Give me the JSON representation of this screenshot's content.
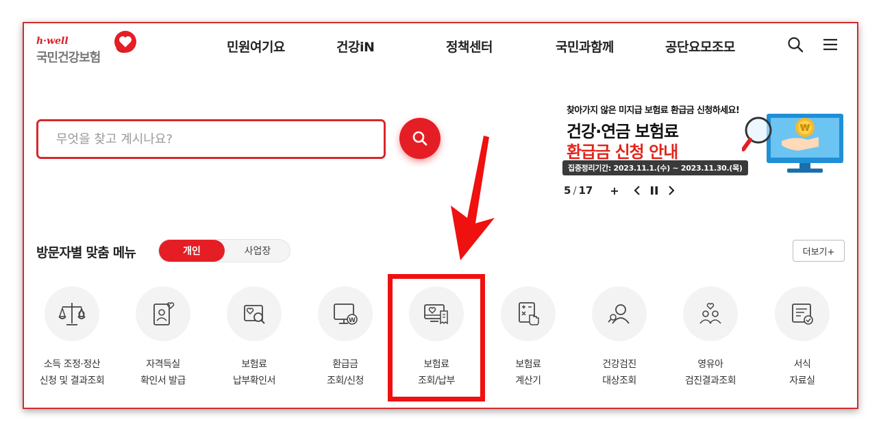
{
  "logo": {
    "brand": "h·well",
    "name": "국민건강보험"
  },
  "nav": {
    "items": [
      "민원여기요",
      "건강iN",
      "정책센터",
      "국민과함께",
      "공단요모조모"
    ]
  },
  "header_icons": [
    "search-icon",
    "hamburger-menu-icon"
  ],
  "search": {
    "placeholder": "무엇을 찾고 계시나요?",
    "value": ""
  },
  "banner": {
    "top_text": "찾아가지 않은 미지급 보험료 환급금 신청하세요!",
    "line1": "건강·연금 보험료",
    "line2": "환급금 신청 안내",
    "period": "집중정리기간: 2023.11.1.(수) ~ 2023.11.30.(목)"
  },
  "pager": {
    "current": "5",
    "total": "17",
    "plus": "+"
  },
  "visitor_menu": {
    "title": "방문자별 맞춤 메뉴",
    "toggle": [
      "개인",
      "사업장"
    ],
    "active_toggle": "개인",
    "more_label": "더보기+",
    "items": [
      {
        "line1": "소득 조정·정산",
        "line2": "신청 및 결과조회",
        "icon": "scale-icon"
      },
      {
        "line1": "자격득실",
        "line2": "확인서 발급",
        "icon": "id-card-heart-icon"
      },
      {
        "line1": "보험료",
        "line2": "납부확인서",
        "icon": "document-search-icon"
      },
      {
        "line1": "환급금",
        "line2": "조회/신청",
        "icon": "monitor-won-icon"
      },
      {
        "line1": "보험료",
        "line2": "조회/납부",
        "icon": "monitor-receipt-icon"
      },
      {
        "line1": "보험료",
        "line2": "계산기",
        "icon": "calculator-icon"
      },
      {
        "line1": "건강검진",
        "line2": "대상조회",
        "icon": "person-search-icon"
      },
      {
        "line1": "영유아",
        "line2": "검진결과조회",
        "icon": "family-heart-icon"
      },
      {
        "line1": "서식",
        "line2": "자료실",
        "icon": "form-document-icon"
      }
    ]
  },
  "annotation": {
    "highlighted_item": "보험료 조회/납부",
    "color": "#ef1010"
  },
  "colors": {
    "brand_red": "#e51e25",
    "frame_red": "#d42a2a",
    "text": "#222222"
  }
}
